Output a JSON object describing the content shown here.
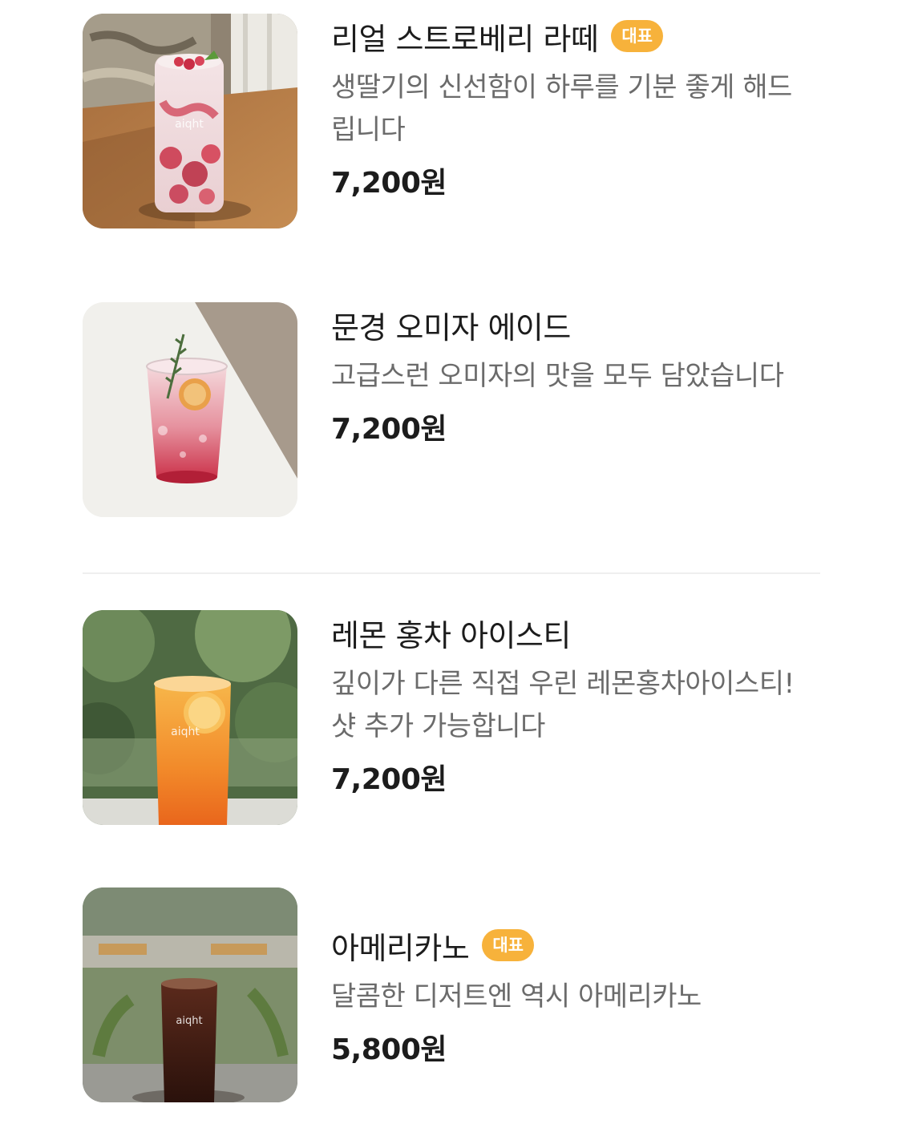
{
  "menu": {
    "items": [
      {
        "name": "리얼 스트로베리 라떼",
        "badge": "대표",
        "description": "생딸기의 신선함이 하루를 기분 좋게 해드립니다",
        "price": "7,200원",
        "image_icon": "strawberry-latte-photo"
      },
      {
        "name": "문경 오미자 에이드",
        "description": "고급스런 오미자의 맛을 모두 담았습니다",
        "price": "7,200원",
        "image_icon": "omija-ade-photo"
      },
      {
        "name": "레몬 홍차 아이스티",
        "description": "깊이가 다른 직접 우린 레몬홍차아이스티! 샷 추가 가능합니다",
        "price": "7,200원",
        "image_icon": "lemon-tea-photo"
      },
      {
        "name": "아메리카노",
        "badge": "대표",
        "description": "달콤한 디저트엔 역시 아메리카노",
        "price": "5,800원",
        "image_icon": "americano-photo"
      }
    ]
  },
  "cup_logo": "aiqht",
  "colors": {
    "badge": "#f7b23b",
    "price": "#1c1c1c",
    "description": "#6b6b6b",
    "divider": "#efefef"
  }
}
